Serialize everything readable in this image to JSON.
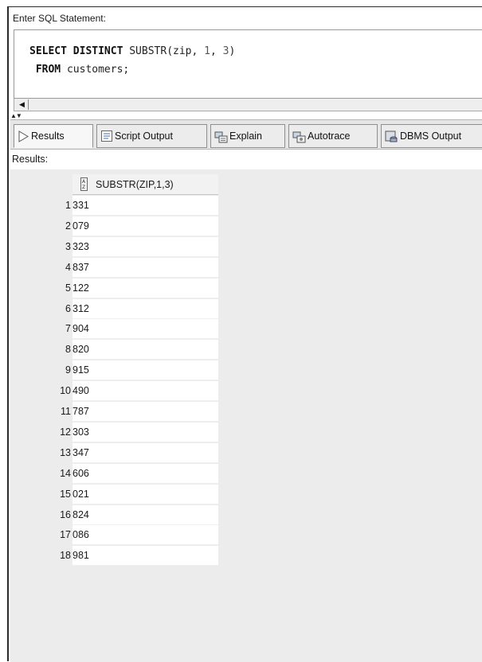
{
  "editor": {
    "label": "Enter SQL Statement:",
    "line1": {
      "kw": "SELECT DISTINCT",
      "rest1": " SUBSTR(zip, ",
      "n1": "1",
      "sep": ", ",
      "n2": "3",
      "rest2": ")"
    },
    "line2": {
      "kw": "FROM",
      "rest": " customers;"
    }
  },
  "tabs": [
    {
      "label": "Results",
      "icon": "play-icon",
      "active": true
    },
    {
      "label": "Script Output",
      "icon": "script-icon"
    },
    {
      "label": "Explain",
      "icon": "explain-icon"
    },
    {
      "label": "Autotrace",
      "icon": "autotrace-icon"
    },
    {
      "label": "DBMS Output",
      "icon": "dbms-icon"
    }
  ],
  "results": {
    "label": "Results:",
    "column": "SUBSTR(ZIP,1,3)",
    "rows": [
      {
        "n": "1",
        "v": "331"
      },
      {
        "n": "2",
        "v": "079"
      },
      {
        "n": "3",
        "v": "323"
      },
      {
        "n": "4",
        "v": "837"
      },
      {
        "n": "5",
        "v": "122"
      },
      {
        "n": "6",
        "v": "312"
      },
      {
        "n": "7",
        "v": "904"
      },
      {
        "n": "8",
        "v": "820"
      },
      {
        "n": "9",
        "v": "915"
      },
      {
        "n": "10",
        "v": "490"
      },
      {
        "n": "11",
        "v": "787"
      },
      {
        "n": "12",
        "v": "303"
      },
      {
        "n": "13",
        "v": "347"
      },
      {
        "n": "14",
        "v": "606"
      },
      {
        "n": "15",
        "v": "021"
      },
      {
        "n": "16",
        "v": "824"
      },
      {
        "n": "17",
        "v": "086"
      },
      {
        "n": "18",
        "v": "981"
      }
    ]
  }
}
